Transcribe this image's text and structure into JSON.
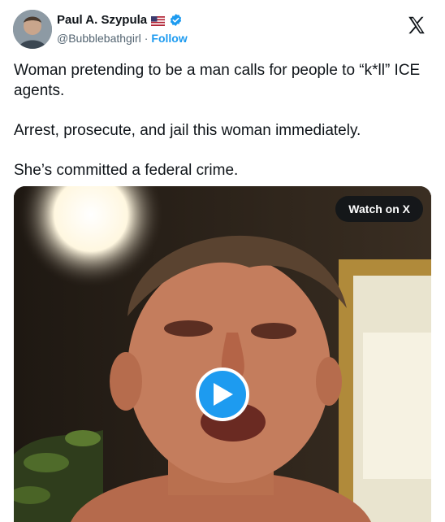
{
  "author": {
    "name": "Paul A. Szypula",
    "handle": "@Bubblebathgirl",
    "separator": "·",
    "follow_label": "Follow",
    "flag_icon": "us-flag-icon",
    "verified_icon": "verified-badge-icon"
  },
  "tweet": {
    "paragraphs": [
      "Woman pretending to be a man calls for people to “k*ll” ICE agents.",
      "Arrest, prosecute, and jail this woman immediately.",
      "She’s committed a federal crime."
    ]
  },
  "media": {
    "watch_label": "Watch on X",
    "play_icon": "play-icon"
  },
  "colors": {
    "accent": "#1d9bf0",
    "text": "#0f1419",
    "secondary": "#536471"
  }
}
